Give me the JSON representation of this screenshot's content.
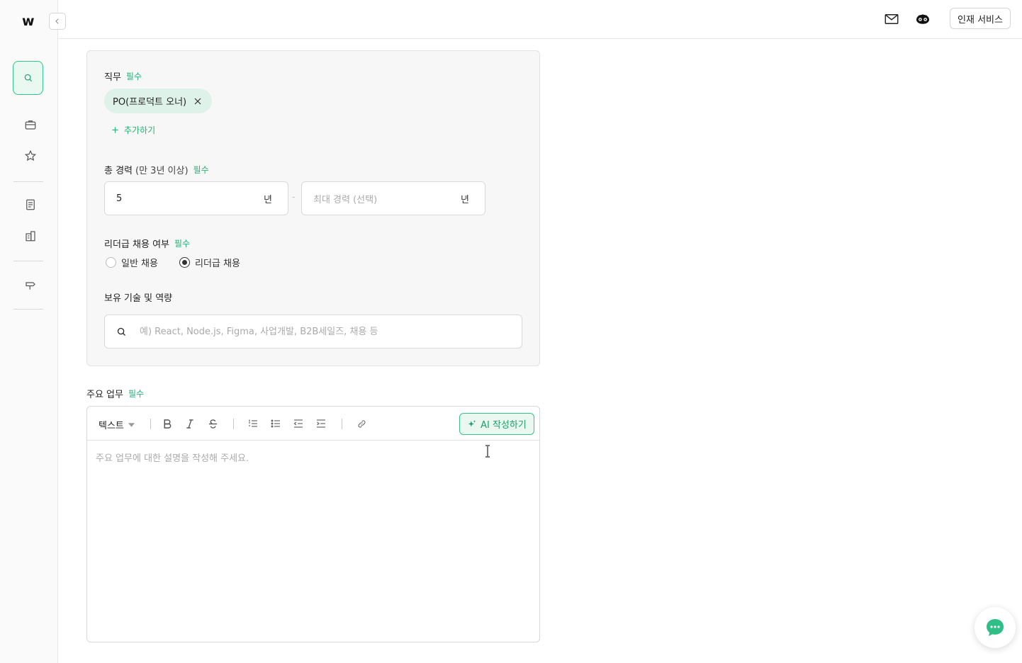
{
  "brand": {
    "logo": "w"
  },
  "header": {
    "hr_service": "인재 서비스"
  },
  "form": {
    "job": {
      "label": "직무",
      "required": "필수",
      "chip": "PO(프로덕트 오너)",
      "add": "추가하기"
    },
    "career": {
      "label": "총 경력",
      "hint": "(만 3년 이상)",
      "required": "필수",
      "min_value": "5",
      "min_unit": "년",
      "max_placeholder": "최대 경력 (선택)",
      "max_unit": "년",
      "separator": "-"
    },
    "leader": {
      "label": "리더급 채용 여부",
      "required": "필수",
      "options": [
        "일반 채용",
        "리더급 채용"
      ],
      "selected_index": 1
    },
    "skills": {
      "label": "보유 기술 및 역량",
      "placeholder": "예) React, Node.js, Figma, 사업개발, B2B세일즈, 채용 등"
    }
  },
  "duties": {
    "label": "주요 업무",
    "required": "필수",
    "toolbar": {
      "text_style": "텍스트",
      "ai_button": "AI 작성하기"
    },
    "placeholder": "주요 업무에 대한 설명을 작성해 주세요."
  },
  "colors": {
    "accent": "#1fb574",
    "accent_bg": "#e9f8f0",
    "chip_bg": "#dff2e9",
    "chat_fab": "#2fbf86"
  }
}
